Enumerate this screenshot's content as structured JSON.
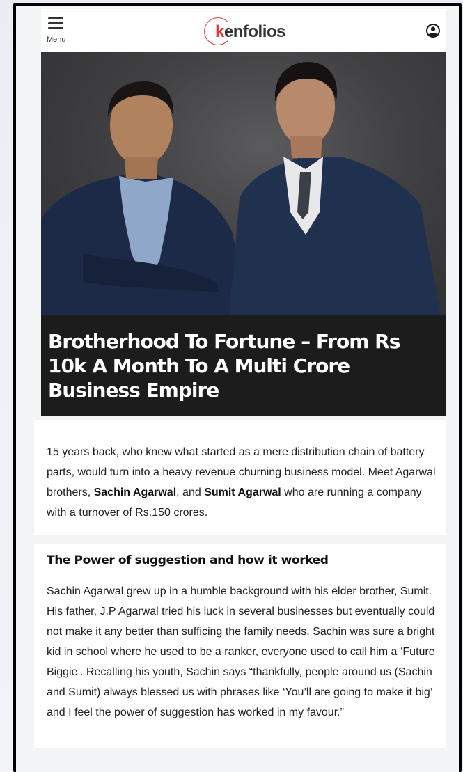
{
  "header": {
    "menu_label": "Menu",
    "logo_k": "k",
    "logo_rest": "enfolios",
    "icons": {
      "menu": "hamburger-menu-icon",
      "account": "user-account-icon"
    }
  },
  "article": {
    "title": "Brotherhood To Fortune – From Rs 10k A Month To A Multi Crore Business Empire",
    "intro": {
      "part1": "15 years back, who knew what started as a mere distribution chain of battery parts, would turn into a heavy revenue churning business model. Meet Agarwal brothers, ",
      "name1": "Sachin Agarwal",
      "part2": ", and ",
      "name2": "Sumit Agarwal",
      "part3": " who are running a company with a turnover of Rs.150 crores."
    },
    "section": {
      "heading": "The Power of suggestion and how it worked",
      "body": "Sachin Agarwal grew up in a humble background with his elder brother, Sumit. His father, J.P Agarwal tried his luck in several businesses but eventually could not make it any better than sufficing the family needs. Sachin was sure a bright kid in school where he used to be a ranker, everyone used to call him a ‘Future Biggie’. Recalling his youth, Sachin says “thankfully, people around us (Sachin and Sumit) always blessed us with phrases like ‘You’ll are going to make it big’ and I feel the power of suggestion has worked in my favour.”"
    }
  },
  "colors": {
    "brand_red": "#e23b3b",
    "title_band": "#1c1c1c",
    "text": "#222222"
  }
}
